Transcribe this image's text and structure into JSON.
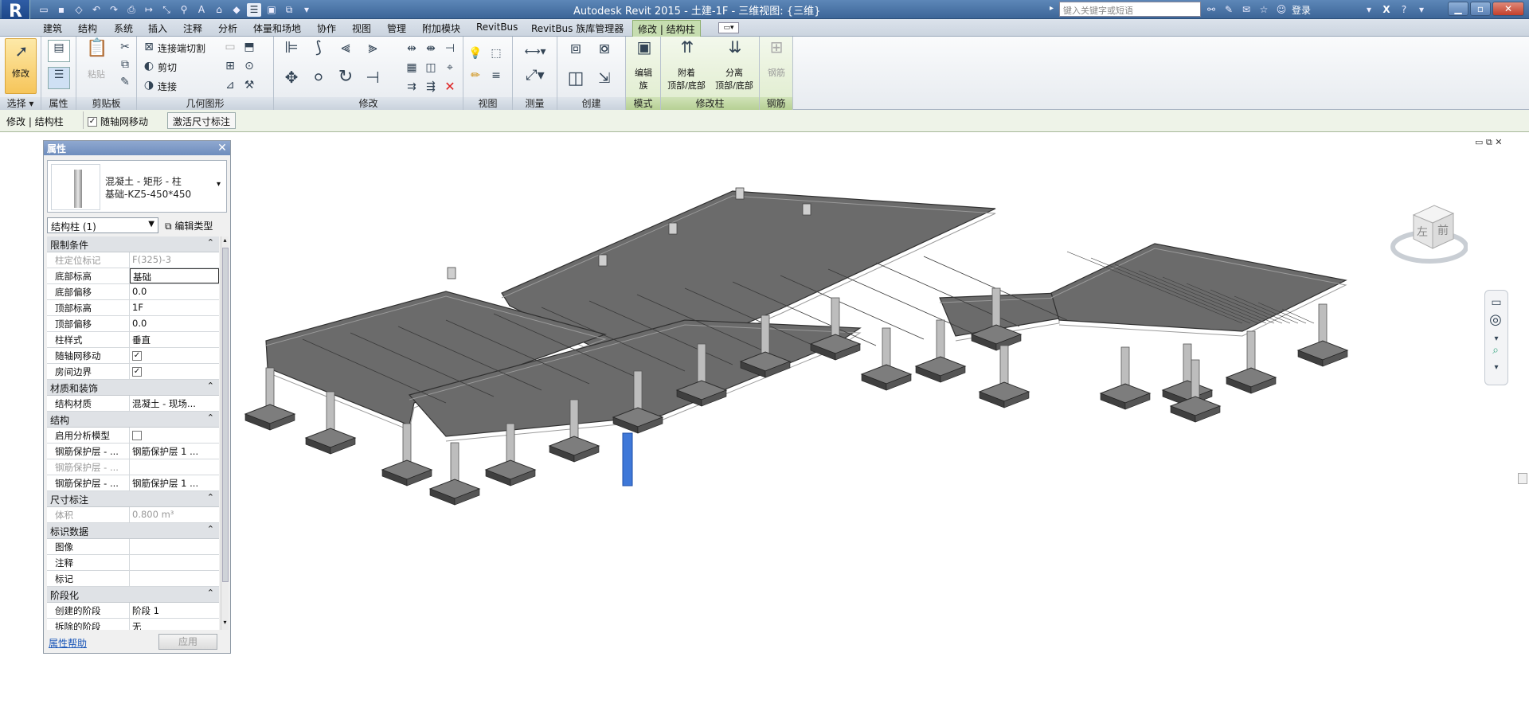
{
  "app": {
    "logo": "R",
    "title": "Autodesk Revit 2015 -      土建-1F - 三维视图: {三维}"
  },
  "search": {
    "placeholder": "键入关键字或短语"
  },
  "user": {
    "login": "登录"
  },
  "tabs": [
    "建筑",
    "结构",
    "系统",
    "插入",
    "注释",
    "分析",
    "体量和场地",
    "协作",
    "视图",
    "管理",
    "附加模块",
    "RevitBus",
    "RevitBus 族库管理器",
    "修改 | 结构柱"
  ],
  "ribbon": {
    "select": {
      "modify": "修改",
      "label": "选择",
      "dropdown": "▾"
    },
    "properties": {
      "label": "属性"
    },
    "clipboard": {
      "paste": "粘贴",
      "label": "剪贴板"
    },
    "geometry": {
      "cut_join": "连接端切割",
      "cut": "剪切",
      "join": "连接",
      "label": "几何图形"
    },
    "modify": {
      "label": "修改"
    },
    "view": {
      "label": "视图"
    },
    "measure": {
      "label": "测量"
    },
    "create": {
      "label": "创建"
    },
    "mode": {
      "edit_family_1": "编辑",
      "edit_family_2": "族",
      "label": "模式"
    },
    "modify_column": {
      "attach_1": "附着",
      "attach_2": "顶部/底部",
      "detach_1": "分离",
      "detach_2": "顶部/底部",
      "label": "修改柱"
    },
    "rebar": {
      "rebar": "钢筋",
      "label": "钢筋"
    }
  },
  "options_bar": {
    "context": "修改 | 结构柱",
    "move_with_grids": "随轴网移动",
    "activate_dims": "激活尺寸标注"
  },
  "properties": {
    "title": "属性",
    "close": "✕",
    "type_line1": "混凝土 - 矩形 - 柱",
    "type_line2": "基础-KZ5-450*450",
    "instance_select": "结构柱 (1)",
    "edit_type": "编辑类型",
    "groups": [
      {
        "name": "限制条件",
        "rows": [
          {
            "k": "柱定位标记",
            "v": "F(325)-3",
            "dim": true
          },
          {
            "k": "底部标高",
            "v": "基础",
            "edit": true
          },
          {
            "k": "底部偏移",
            "v": "0.0"
          },
          {
            "k": "顶部标高",
            "v": "1F"
          },
          {
            "k": "顶部偏移",
            "v": "0.0"
          },
          {
            "k": "柱样式",
            "v": "垂直"
          },
          {
            "k": "随轴网移动",
            "check": true
          },
          {
            "k": "房间边界",
            "check": true
          }
        ]
      },
      {
        "name": "材质和装饰",
        "rows": [
          {
            "k": "结构材质",
            "v": "混凝土 - 现场..."
          }
        ]
      },
      {
        "name": "结构",
        "rows": [
          {
            "k": "启用分析模型",
            "check": false
          },
          {
            "k": "钢筋保护层 - ...",
            "v": "钢筋保护层 1 ..."
          },
          {
            "k": "钢筋保护层 - ...",
            "v": "",
            "dim": true
          },
          {
            "k": "钢筋保护层 - ...",
            "v": "钢筋保护层 1 ..."
          }
        ]
      },
      {
        "name": "尺寸标注",
        "rows": [
          {
            "k": "体积",
            "v": "0.800 m³",
            "dim": true
          }
        ]
      },
      {
        "name": "标识数据",
        "rows": [
          {
            "k": "图像",
            "v": ""
          },
          {
            "k": "注释",
            "v": ""
          },
          {
            "k": "标记",
            "v": ""
          }
        ]
      },
      {
        "name": "阶段化",
        "rows": [
          {
            "k": "创建的阶段",
            "v": "阶段 1"
          },
          {
            "k": "拆除的阶段",
            "v": "无"
          }
        ]
      }
    ],
    "help": "属性帮助",
    "apply": "应用"
  },
  "viewcube": {
    "left": "左",
    "front": "前"
  },
  "colors": {
    "accent_tab": "#c6ddb0",
    "selected_column": "#3f78d8"
  }
}
